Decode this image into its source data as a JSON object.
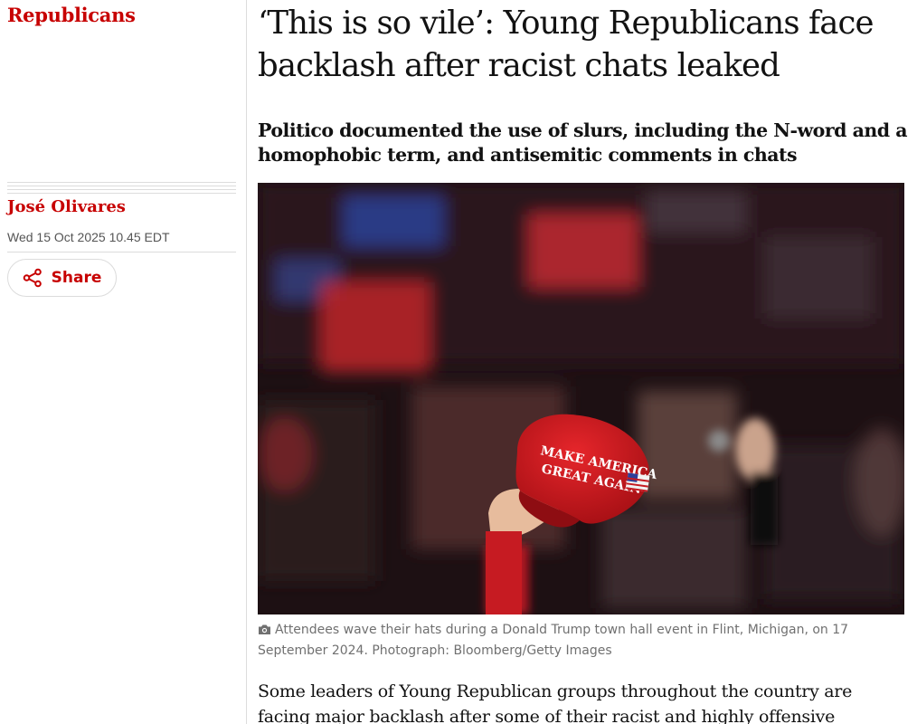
{
  "section": {
    "label": "Republicans"
  },
  "article": {
    "headline": "‘This is so vile’: Young Republicans face backlash after racist chats leaked",
    "standfirst": "Politico documented the use of slurs, including the N-word and a homophobic term, and antisemitic comments in chats",
    "byline": "José Olivares",
    "date": "Wed 15 Oct 2025 10.45 EDT",
    "share_label": "Share",
    "image": {
      "hat_line1": "MAKE AMERICA",
      "hat_line2": "GREAT AGAIN",
      "caption": "Attendees wave their hats during a Donald Trump town hall event in Flint, Michigan, on 17 September 2024. Photograph: Bloomberg/Getty Images"
    },
    "body": "Some leaders of Young Republican groups throughout the country are facing major backlash after some of their racist and highly offensive messages in"
  },
  "colors": {
    "accent": "#c70000",
    "text": "#121212",
    "caption": "#707070",
    "rule": "#dcdcdc"
  },
  "icons": {
    "share": "share-icon",
    "caption": "camera-icon"
  }
}
